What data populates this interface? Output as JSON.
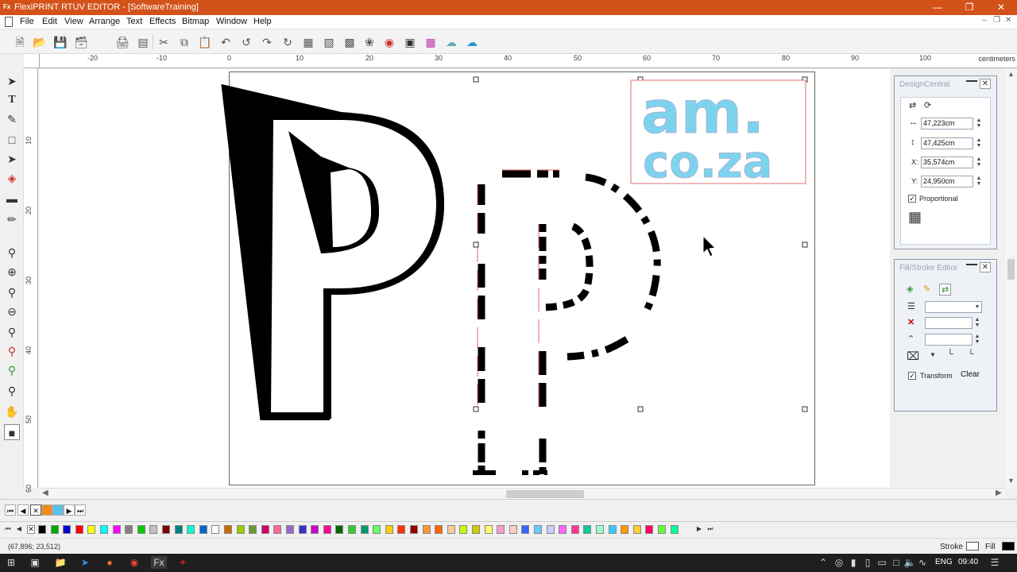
{
  "window": {
    "title": "FlexiPRINT RTUV EDITOR - [SoftwareTraining]",
    "app_icon_text": "Fx"
  },
  "menu": [
    "File",
    "Edit",
    "View",
    "Arrange",
    "Text",
    "Effects",
    "Bitmap",
    "Window",
    "Help"
  ],
  "toolbar": {
    "icons": [
      "new-icon",
      "open-icon",
      "save-icon",
      "save-all-icon",
      "print-icon",
      "print-setup-icon",
      "cut-icon",
      "copy-icon",
      "paste-icon",
      "undo-icon",
      "undo-all-icon",
      "redo-icon",
      "redo-all-icon",
      "align-icon",
      "distribute-icon",
      "arrange-icon",
      "color-wheel-icon",
      "zoom-tool-icon",
      "color-grid-icon",
      "color-palette-icon",
      "cloud-icon",
      "upload-cloud-icon"
    ]
  },
  "rulers": {
    "horizontal_ticks": [
      "-20",
      "-10",
      "0",
      "10",
      "20",
      "30",
      "40",
      "50",
      "60",
      "70",
      "80",
      "90",
      "100"
    ],
    "units": "centimeters",
    "vertical_ticks": [
      "10",
      "20",
      "30",
      "40",
      "50",
      "60"
    ]
  },
  "tools": [
    "pointer-tool-icon",
    "text-tool-icon",
    "shape-tool-icon",
    "rectangle-tool-icon",
    "node-edit-tool-icon",
    "fill-tool-icon",
    "measure-tool-icon",
    "eyedropper-tool-icon",
    "zoom-in-tool-icon",
    "zoom-plus-icon",
    "zoom-minus-icon",
    "zoom-fit-icon",
    "zoom-page-icon",
    "zoom-selection-icon",
    "zoom-all-icon",
    "zoom-actual-icon",
    "pan-tool-icon",
    "color-swatch-tool-icon"
  ],
  "artwork": {
    "logo_line1": "am.",
    "logo_line2": "co.za",
    "logo_color": "#7dd3ee"
  },
  "design_central": {
    "title": "DesignCentral",
    "width": "47,223cm",
    "height": "47,425cm",
    "x_label": "X:",
    "x": "35,574cm",
    "y_label": "Y:",
    "y": "24,950cm",
    "proportional_label": "Proportional",
    "proportional_checked": true
  },
  "fill_stroke": {
    "title": "Fill/Stroke Editor",
    "transform_label": "Transform",
    "transform_checked": true,
    "clear_label": "Clear"
  },
  "palette_colors": [
    "#000000",
    "#00aa00",
    "#0000cc",
    "#ff0000",
    "#ffff00",
    "#00ffff",
    "#ff00ff",
    "#808080",
    "#00cc00",
    "#c0c0c0",
    "#800000",
    "#008080",
    "#00ffcc",
    "#0066cc",
    "#ffffff",
    "#cc6600",
    "#99cc00",
    "#669933",
    "#cc0066",
    "#ff6699",
    "#9966cc",
    "#3333cc",
    "#cc00cc",
    "#ff0099",
    "#006600",
    "#33cc33",
    "#009966",
    "#66ff66",
    "#ffcc00",
    "#ff3300",
    "#990000",
    "#ff9933",
    "#ff6600",
    "#ffcc99",
    "#ccff00",
    "#cccc00",
    "#ffff66",
    "#ff99cc",
    "#ffcccc",
    "#3366ff",
    "#66ccff",
    "#ccccff",
    "#ff66ff",
    "#ff3399",
    "#00cc99",
    "#99ffcc",
    "#33ccff",
    "#ff9900",
    "#ffcc33",
    "#ff0066",
    "#66ff33",
    "#00ff99"
  ],
  "status": {
    "coords": "(67,896;   23,512)",
    "stroke_label": "Stroke",
    "fill_label": "Fill"
  },
  "taskbar": {
    "lang": "ENG",
    "time": "09:40"
  }
}
